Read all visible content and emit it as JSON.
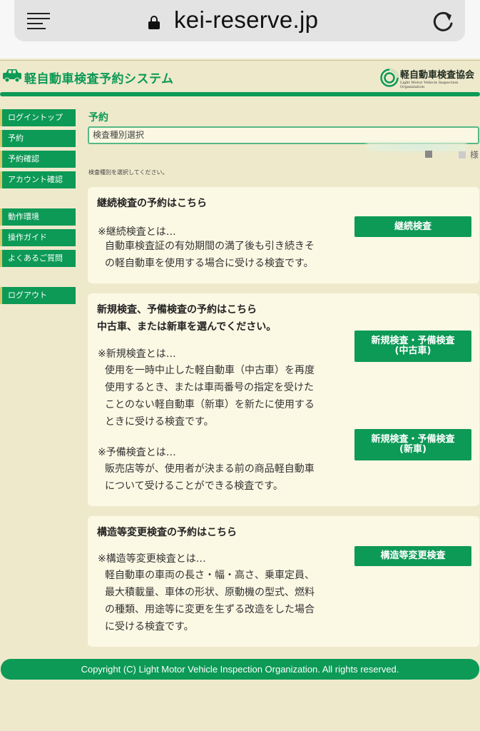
{
  "browser": {
    "url": "kei-reserve.jp"
  },
  "header": {
    "site_title": "軽自動車検査予約システム",
    "org_name": "軽自動車検査協会",
    "org_sub": "Light Motor Vehicle Inspection Organization"
  },
  "sidebar": {
    "items": [
      {
        "label": "ログイントップ"
      },
      {
        "label": "予約"
      },
      {
        "label": "予約確認"
      },
      {
        "label": "アカウント確認"
      },
      {
        "label": "動作環境"
      },
      {
        "label": "操作ガイド"
      },
      {
        "label": "よくあるご質問"
      },
      {
        "label": "ログアウト"
      }
    ]
  },
  "main": {
    "section_title": "予約",
    "section_subtitle": "検査種別選択",
    "user_suffix": "様",
    "hint": "検査種別を選択してください。",
    "cards": [
      {
        "heading": "継続検査の予約はこちら",
        "notes": [
          {
            "title": "※継続検査とは…",
            "lines": [
              "自動車検査証の有効期間の満了後も引き続きそ",
              "の軽自動車を使用する場合に受ける検査です。"
            ]
          }
        ],
        "buttons": [
          {
            "line1": "継続検査"
          }
        ]
      },
      {
        "heading_lines": [
          "新規検査、予備検査の予約はこちら",
          "中古車、または新車を選んでください。"
        ],
        "notes": [
          {
            "title": "※新規検査とは…",
            "lines": [
              "使用を一時中止した軽自動車（中古車）を再度",
              "使用するとき、または車両番号の指定を受けた",
              "ことのない軽自動車（新車）を新たに使用する",
              "ときに受ける検査です。"
            ]
          },
          {
            "title": "※予備検査とは…",
            "lines": [
              "販売店等が、使用者が決まる前の商品軽自動車",
              "について受けることができる検査です。"
            ]
          }
        ],
        "buttons": [
          {
            "line1": "新規検査・予備検査",
            "line2": "(中古車)"
          },
          {
            "line1": "新規検査・予備検査",
            "line2": "(新車)"
          }
        ]
      },
      {
        "heading": "構造等変更検査の予約はこちら",
        "notes": [
          {
            "title": "※構造等変更検査とは…",
            "lines": [
              "軽自動車の車両の長さ・幅・高さ、乗車定員、",
              "最大積載量、車体の形状、原動機の型式、燃料",
              "の種類、用途等に変更を生ずる改造をした場合",
              "に受ける検査です。"
            ]
          }
        ],
        "buttons": [
          {
            "line1": "構造等変更検査"
          }
        ]
      }
    ]
  },
  "footer": {
    "copyright": "Copyright (C) Light Motor Vehicle Inspection Organization. All rights reserved."
  },
  "colors": {
    "brand_green": "#0c9a56",
    "background": "#efe9cc",
    "card": "#fbf8e4"
  }
}
